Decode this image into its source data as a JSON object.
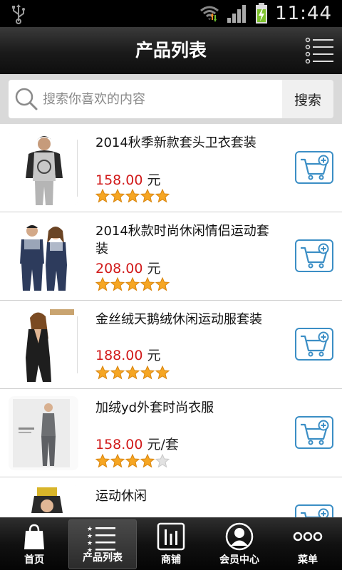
{
  "status_bar": {
    "time": "11:44",
    "icons": [
      "usb-icon",
      "wifi-icon",
      "signal-icon",
      "battery-charging-icon"
    ]
  },
  "header": {
    "title": "产品列表",
    "menu_icon": "list-menu-icon"
  },
  "search": {
    "placeholder": "搜索你喜欢的内容",
    "button_label": "搜索"
  },
  "products": [
    {
      "name": "2014秋季新款套头卫衣套装",
      "price": "158.00",
      "unit": "元",
      "rating": 5
    },
    {
      "name": "2014秋款时尚休闲情侣运动套装",
      "price": "208.00",
      "unit": "元",
      "rating": 5
    },
    {
      "name": "金丝绒天鹅绒休闲运动服套装",
      "price": "188.00",
      "unit": "元",
      "rating": 5
    },
    {
      "name": "加绒yd外套时尚衣服",
      "price": "158.00",
      "unit": "元/套",
      "rating": 4
    },
    {
      "name": "运动休闲",
      "price": "",
      "unit": "",
      "rating": 0
    }
  ],
  "bottom_nav": [
    {
      "label": "首页",
      "icon": "shopping-bag-icon",
      "active": false
    },
    {
      "label": "产品列表",
      "icon": "star-list-icon",
      "active": true
    },
    {
      "label": "商铺",
      "icon": "shop-bars-icon",
      "active": false
    },
    {
      "label": "会员中心",
      "icon": "member-avatar-icon",
      "active": false
    },
    {
      "label": "菜单",
      "icon": "more-dots-icon",
      "active": false
    }
  ],
  "colors": {
    "price": "#d11a1a",
    "cart_border": "#3b8ec5",
    "star": "#f6a623"
  }
}
